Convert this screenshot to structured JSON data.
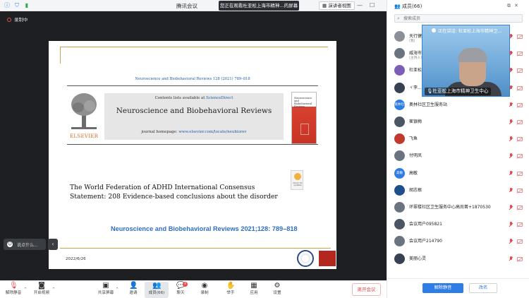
{
  "app": {
    "title": "腾讯会议",
    "sharing_banner": "您正在观看杜亚松上海市精神...的屏幕",
    "view_mode_label": "演讲者视图",
    "recording_label": "录制中"
  },
  "slide": {
    "citation_header": "Neuroscience and Biobehavioral Reviews 128 (2021) 789–818",
    "contents_prefix": "Contents lists available at",
    "contents_link": "ScienceDirect",
    "journal_name": "Neuroscience and Biobehavioral Reviews",
    "homepage_prefix": "journal homepage:",
    "homepage_url": "www.elsevier.com/locate/neubiorev",
    "publisher_label": "ELSEVIER",
    "cover_title": "Neuroscience and Biobehavioral Reviews",
    "check_updates_label": "Check for updates",
    "paper_title": "The World Federation of ADHD International Consensus Statement: 208 Evidence-based conclusions about the disorder",
    "big_citation": "Neuroscience and Biobehavioral Reviews 2021;128: 789–818",
    "date": "2022/6/26"
  },
  "chat": {
    "input_placeholder": "说点什么...",
    "collapse_icon": "chevron-left-icon"
  },
  "toolbar": {
    "unmute_label": "解除静音",
    "video_label": "开启视频",
    "share_label": "共享屏幕",
    "invite_label": "邀请",
    "members_label": "成员(66)",
    "chat_label": "聊天",
    "chat_badge": "4",
    "record_label": "录制",
    "raise_hand_label": "举手",
    "apps_label": "应用",
    "settings_label": "设置",
    "leave_label": "离开会议"
  },
  "sidebar": {
    "title": "成员(66)",
    "search_placeholder": "搜索成员",
    "speaking_label": "正在讲话: 杜亚松上海市精神卫...",
    "speaker_name": "杜亚松上海市精神卫生中心",
    "members": [
      {
        "name": "天行健",
        "role": "(我)",
        "avatar_text": "",
        "avatar_color": "#8a8f98"
      },
      {
        "name": "威海市...",
        "role": "(主持人)",
        "avatar_text": "",
        "avatar_color": "#6b7280"
      },
      {
        "name": "杜亚松...",
        "role": "",
        "avatar_text": "",
        "avatar_color": "#7c5fb5"
      },
      {
        "name": "ヾ李...",
        "role": "",
        "avatar_text": "",
        "avatar_color": "#374151"
      },
      {
        "name": "奥林社区卫生服务站",
        "role": "",
        "avatar_text": "奥林社区",
        "avatar_color": "#2e7ce6"
      },
      {
        "name": "崔银梅",
        "role": "",
        "avatar_text": "",
        "avatar_color": "#4b5563"
      },
      {
        "name": "飞鱼",
        "role": "",
        "avatar_text": "",
        "avatar_color": "#c0392b"
      },
      {
        "name": "付明凤",
        "role": "",
        "avatar_text": "",
        "avatar_color": "#6b7280"
      },
      {
        "name": "高敏",
        "role": "",
        "avatar_text": "高敏",
        "avatar_color": "#2e7ce6"
      },
      {
        "name": "胡志根",
        "role": "",
        "avatar_text": "",
        "avatar_color": "#1f4f8a"
      },
      {
        "name": "环翠楼社区卫生服务中心高尚菁+1870530",
        "role": "",
        "avatar_text": "",
        "avatar_color": "#6b7280"
      },
      {
        "name": "会议用户095821",
        "role": "",
        "avatar_text": "",
        "avatar_color": "#4b5563"
      },
      {
        "name": "会议用户214790",
        "role": "",
        "avatar_text": "",
        "avatar_color": "#6b7280"
      },
      {
        "name": "美丽心灵",
        "role": "",
        "avatar_text": "",
        "avatar_color": "#374151"
      }
    ],
    "unmute_all_label": "解除静音",
    "more_label": "改名"
  }
}
